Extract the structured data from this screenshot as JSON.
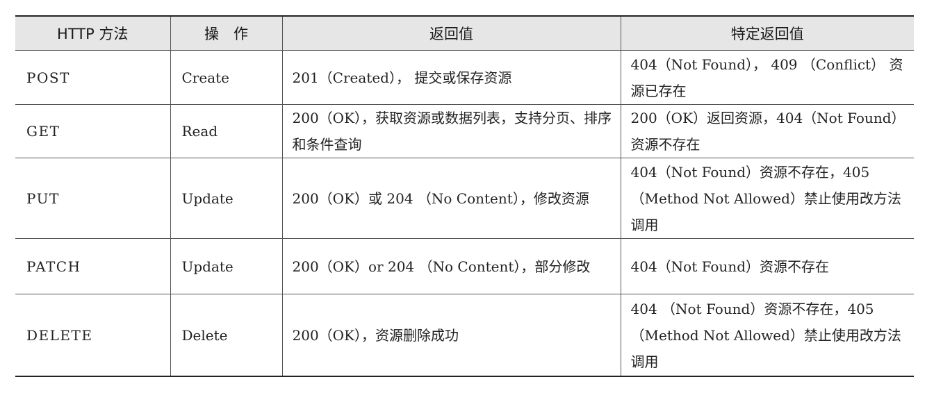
{
  "table": {
    "headers": [
      "HTTP 方法",
      "操　作",
      "返回值",
      "特定返回值"
    ],
    "rows": [
      {
        "method": "POST",
        "operation": "Create",
        "return": "201（Created）， 提交或保存资源",
        "specific": "404（Not Found）， 409 （Conflict） 资源已存在"
      },
      {
        "method": "GET",
        "operation": "Read",
        "return": "200（OK），获取资源或数据列表，支持分页、排序和条件查询",
        "specific": "200（OK）返回资源，404（Not Found）资源不存在"
      },
      {
        "method": "PUT",
        "operation": "Update",
        "return": "200（OK）或 204 （No Content），修改资源",
        "specific": "404（Not Found）资源不存在，405（Method Not Allowed）禁止使用改方法调用"
      },
      {
        "method": "PATCH",
        "operation": "Update",
        "return": "200（OK）or 204 （No Content），部分修改",
        "specific": "404（Not Found）资源不存在"
      },
      {
        "method": "DELETE",
        "operation": "Delete",
        "return": "200（OK），资源删除成功",
        "specific": "404 （Not Found）资源不存在，405（Method Not Allowed）禁止使用改方法调用"
      }
    ]
  }
}
